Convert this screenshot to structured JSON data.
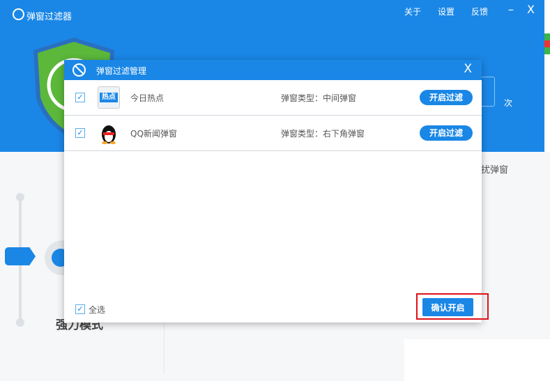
{
  "app": {
    "title": "弹窗过滤器",
    "nav": [
      "关于",
      "设置",
      "反馈"
    ],
    "minimize": "–",
    "close": "X"
  },
  "background": {
    "hint_text": "扰弹窗",
    "counter_unit": "次",
    "mode_label": "强力模式"
  },
  "dialog": {
    "title": "弹窗过滤管理",
    "close": "X",
    "rows": [
      {
        "checked": true,
        "icon": "jinri-redian-icon",
        "icon_text": "热点",
        "name": "今日热点",
        "type": "弹窗类型：中间弹窗",
        "button": "开启过滤"
      },
      {
        "checked": true,
        "icon": "qq-penguin-icon",
        "name": "QQ新闻弹窗",
        "type": "弹窗类型：右下角弹窗",
        "button": "开启过滤"
      }
    ],
    "select_all": {
      "checked": true,
      "label": "全选"
    },
    "confirm": "确认开启"
  },
  "colors": {
    "primary": "#1a87e6",
    "highlight": "#e0101a",
    "shield": "#5bb83a"
  }
}
